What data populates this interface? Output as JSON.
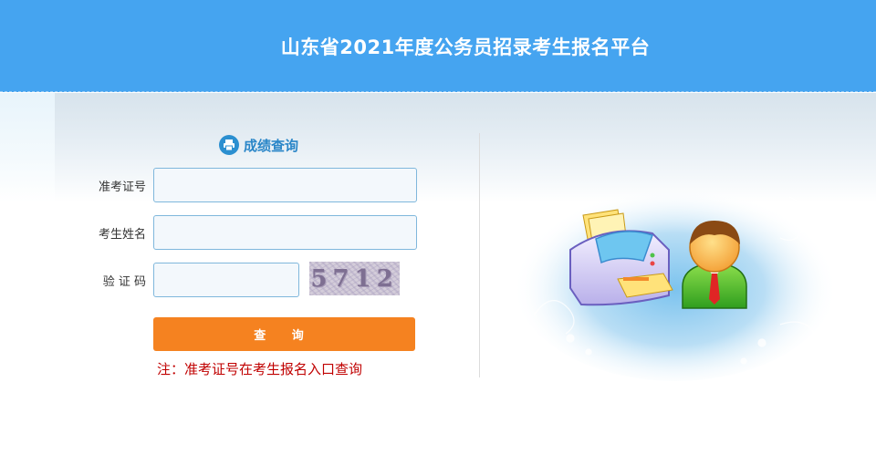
{
  "header": {
    "title": "山东省2021年度公务员招录考生报名平台"
  },
  "form": {
    "section_title": "成绩查询",
    "section_icon": "printer-icon",
    "fields": [
      {
        "label": "准考证号",
        "value": "",
        "placeholder": ""
      },
      {
        "label": "考生姓名",
        "value": "",
        "placeholder": ""
      },
      {
        "label": "验 证 码",
        "value": "",
        "placeholder": ""
      }
    ],
    "captcha_text": "5712",
    "submit_label": "查 询",
    "note": "注：准考证号在考生报名入口查询"
  },
  "illustration": {
    "icons": [
      "printer-icon",
      "user-avatar-icon"
    ]
  },
  "colors": {
    "header_bg": "#45a4f0",
    "accent_blue": "#2a86c8",
    "button_orange": "#f58220",
    "note_red": "#c00000"
  }
}
